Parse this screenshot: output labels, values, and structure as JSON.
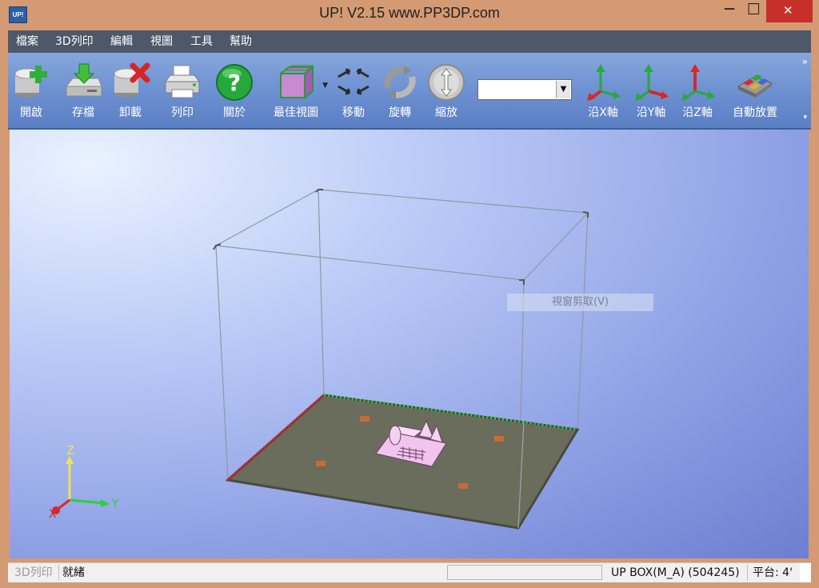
{
  "window": {
    "title": "UP!  V2.15 www.PP3DP.com",
    "app_icon_text": "UP!",
    "controls": {
      "minimize": "—",
      "maximize": "☐",
      "close": "✕"
    }
  },
  "menubar": {
    "items": [
      "檔案",
      "3D列印",
      "編輯",
      "視圖",
      "工具",
      "幫助"
    ]
  },
  "toolbar": {
    "buttons": [
      {
        "label": "開啟",
        "icon": "open-cylinder-plus-icon"
      },
      {
        "label": "存檔",
        "icon": "save-drive-arrow-icon"
      },
      {
        "label": "卸載",
        "icon": "unload-cylinder-x-icon"
      },
      {
        "label": "列印",
        "icon": "printer-icon"
      },
      {
        "label": "關於",
        "icon": "help-question-icon"
      },
      {
        "label": "最佳視圖",
        "icon": "best-view-cube-icon"
      },
      {
        "label": "移動",
        "icon": "move-arrows-icon"
      },
      {
        "label": "旋轉",
        "icon": "rotate-icon"
      },
      {
        "label": "縮放",
        "icon": "scale-icon"
      },
      {
        "label": "沿X軸",
        "icon": "x-axis-icon"
      },
      {
        "label": "沿Y軸",
        "icon": "y-axis-icon"
      },
      {
        "label": "沿Z軸",
        "icon": "z-axis-icon"
      },
      {
        "label": "自動放置",
        "icon": "auto-place-icon"
      }
    ],
    "combo_value": "",
    "overflow": "»",
    "more": "▾"
  },
  "viewport": {
    "context_menu_item": "視窗剪取(V)",
    "axes": {
      "x": "X",
      "y": "Y",
      "z": "Z"
    }
  },
  "statusbar": {
    "mode": "3D列印",
    "status": "就緒",
    "printer": "UP BOX(M_A) (504245)",
    "platform": "平台: 4'"
  },
  "colors": {
    "title_bar": "#d49a74",
    "menu_bar": "#4d5869",
    "close_button": "#c7302a",
    "platform": "#6a6d5c",
    "x_edge": "#d8282a",
    "y_edge": "#2fcf3a",
    "model": "#f0c4ec"
  }
}
